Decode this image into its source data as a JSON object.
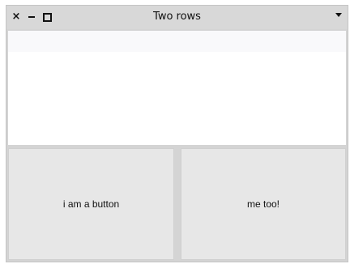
{
  "window": {
    "title": "Two rows",
    "controls": {
      "close_glyph": "×",
      "close_icon": "close-icon",
      "minimize_icon": "minimize-icon",
      "maximize_icon": "maximize-icon",
      "menu_icon": "dropdown-arrow-icon"
    }
  },
  "buttons": [
    {
      "label": "i am a button"
    },
    {
      "label": "me too!"
    }
  ],
  "colors": {
    "titlebar": "#d8d8d8",
    "content": "#ffffff",
    "button": "#e7e7e7"
  }
}
